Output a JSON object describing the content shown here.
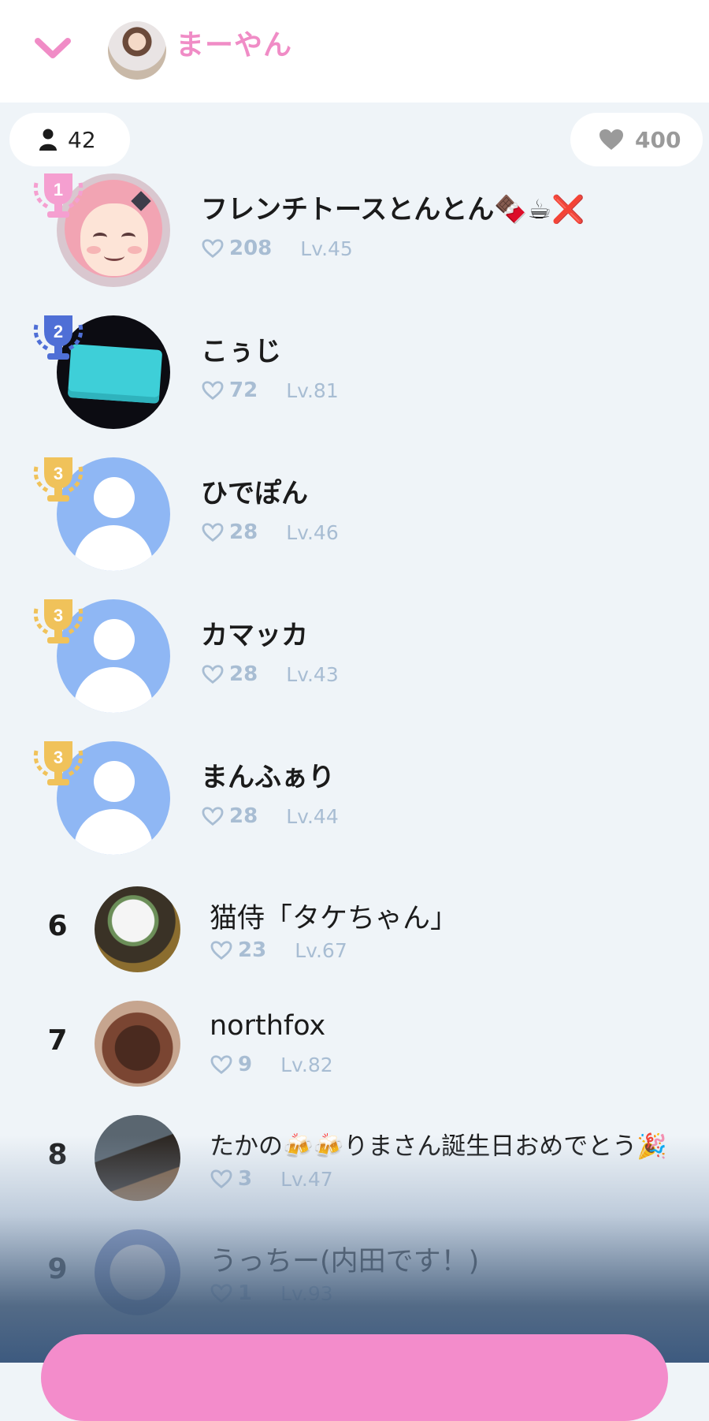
{
  "header": {
    "host_name": "まーやん",
    "collapse_icon": "chevron-down-icon",
    "accent_color": "#f08cc6"
  },
  "stats_bar": {
    "viewer_count": "42",
    "like_count": "400"
  },
  "ranking": [
    {
      "rank": "1",
      "name": "フレンチトースとんとん🍫☕❌",
      "likes": "208",
      "level": "Lv.45",
      "avatar": "anime-girl-pink-hair",
      "trophy_color": "#f59fd0"
    },
    {
      "rank": "2",
      "name": "こぅじ",
      "likes": "72",
      "level": "Lv.81",
      "avatar": "teal-cloth",
      "trophy_color": "#4f6fd6"
    },
    {
      "rank": "3",
      "name": "ひでぽん",
      "likes": "28",
      "level": "Lv.46",
      "avatar": "default",
      "trophy_color": "#f0c25a"
    },
    {
      "rank": "3",
      "name": "カマッカ",
      "likes": "28",
      "level": "Lv.43",
      "avatar": "default",
      "trophy_color": "#f0c25a"
    },
    {
      "rank": "3",
      "name": "まんふぁり",
      "likes": "28",
      "level": "Lv.44",
      "avatar": "default",
      "trophy_color": "#f0c25a"
    },
    {
      "rank": "6",
      "name": "猫侍「タケちゃん」",
      "likes": "23",
      "level": "Lv.67",
      "avatar": "cat-photo"
    },
    {
      "rank": "7",
      "name": "northfox",
      "likes": "9",
      "level": "Lv.82",
      "avatar": "cake-photo"
    },
    {
      "rank": "8",
      "name": "たかの🍻🍻りまさん誕生日おめでとう🎉",
      "likes": "3",
      "level": "Lv.47",
      "avatar": "room-photo"
    },
    {
      "rank": "9",
      "name": "うっちー(内田です！)",
      "likes": "1",
      "level": "Lv.93",
      "avatar": "plush-seals-photo"
    }
  ]
}
